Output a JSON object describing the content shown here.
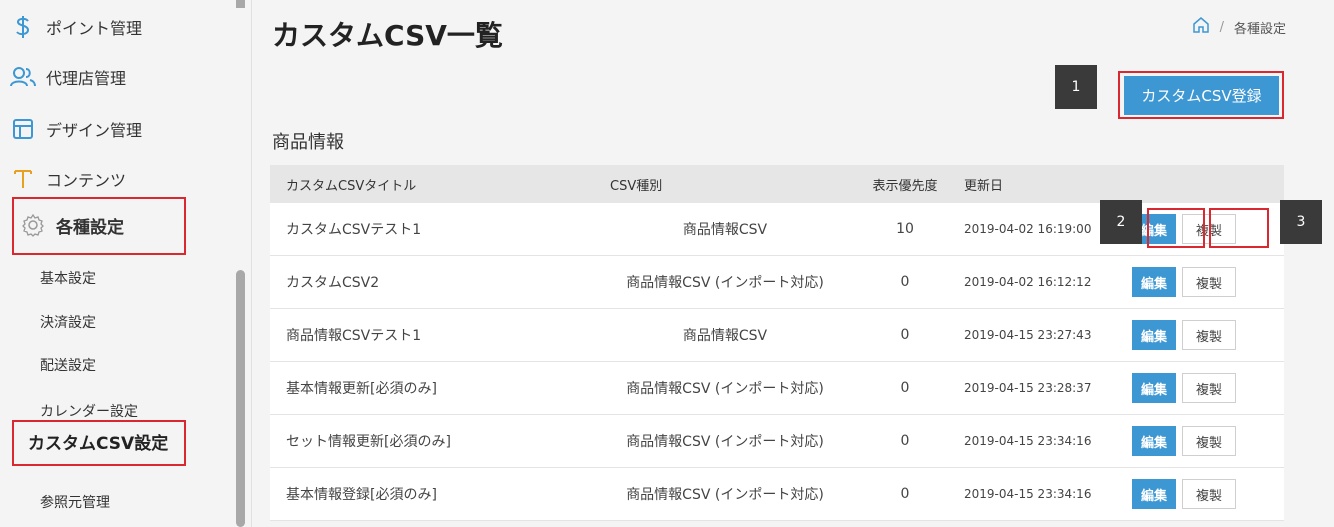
{
  "sidebar": {
    "items": [
      {
        "label": "ポイント管理",
        "icon": "dollar-icon"
      },
      {
        "label": "代理店管理",
        "icon": "users-icon"
      },
      {
        "label": "デザイン管理",
        "icon": "layout-icon"
      },
      {
        "label": "コンテンツ",
        "icon": "text-icon"
      },
      {
        "label": "各種設定",
        "icon": "gear-icon"
      }
    ],
    "sub_items": [
      "基本設定",
      "決済設定",
      "配送設定",
      "カレンダー設定",
      "カスタムCSV設定",
      "参照元管理"
    ]
  },
  "page": {
    "title": "カスタムCSV一覧",
    "breadcrumb_current": "各種設定",
    "register_button": "カスタムCSV登録",
    "section_title": "商品情報"
  },
  "badges": [
    "1",
    "2",
    "3"
  ],
  "table": {
    "headers": [
      "カスタムCSVタイトル",
      "CSV種別",
      "表示優先度",
      "更新日"
    ],
    "rows": [
      {
        "title": "カスタムCSVテスト1",
        "type": "商品情報CSV",
        "priority": "10",
        "updated": "2019-04-02 16:19:00"
      },
      {
        "title": "カスタムCSV2",
        "type": "商品情報CSV (インポート対応)",
        "priority": "0",
        "updated": "2019-04-02 16:12:12"
      },
      {
        "title": "商品情報CSVテスト1",
        "type": "商品情報CSV",
        "priority": "0",
        "updated": "2019-04-15 23:27:43"
      },
      {
        "title": "基本情報更新[必須のみ]",
        "type": "商品情報CSV (インポート対応)",
        "priority": "0",
        "updated": "2019-04-15 23:28:37"
      },
      {
        "title": "セット情報更新[必須のみ]",
        "type": "商品情報CSV (インポート対応)",
        "priority": "0",
        "updated": "2019-04-15 23:34:16"
      },
      {
        "title": "基本情報登録[必須のみ]",
        "type": "商品情報CSV (インポート対応)",
        "priority": "0",
        "updated": "2019-04-15 23:34:16"
      }
    ],
    "edit_label": "編集",
    "copy_label": "複製"
  },
  "colors": {
    "accent": "#3d97d3",
    "highlight": "#d9282f",
    "nav_icon": "#3d97d3",
    "text_icon": "#e8a020"
  }
}
